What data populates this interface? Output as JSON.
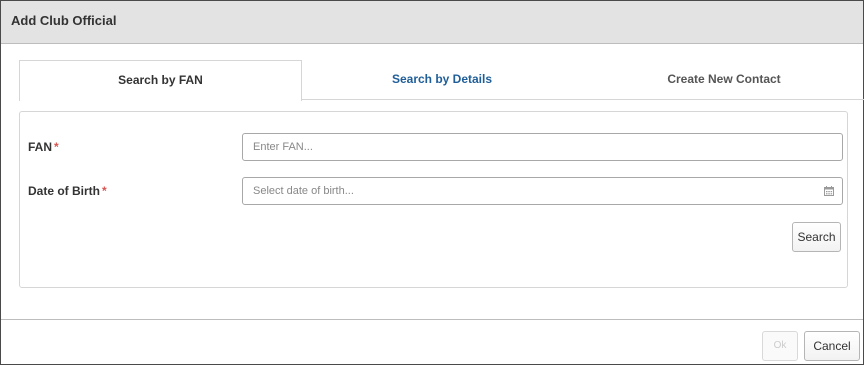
{
  "dialog": {
    "title": "Add Club Official"
  },
  "tabs": [
    {
      "label": "Search by FAN"
    },
    {
      "label": "Search by Details"
    },
    {
      "label": "Create New Contact"
    }
  ],
  "form": {
    "fan": {
      "label": "FAN",
      "required_mark": "*",
      "placeholder": "Enter FAN..."
    },
    "dob": {
      "label": "Date of Birth",
      "required_mark": "*",
      "placeholder": "Select date of birth...",
      "icon": "calendar-icon"
    },
    "search_label": "Search"
  },
  "footer": {
    "ok_label": "Ok",
    "cancel_label": "Cancel"
  },
  "colors": {
    "header_bg": "#e3e3e3",
    "active_tab_link": "#1f5e98",
    "required": "#d9534f"
  }
}
